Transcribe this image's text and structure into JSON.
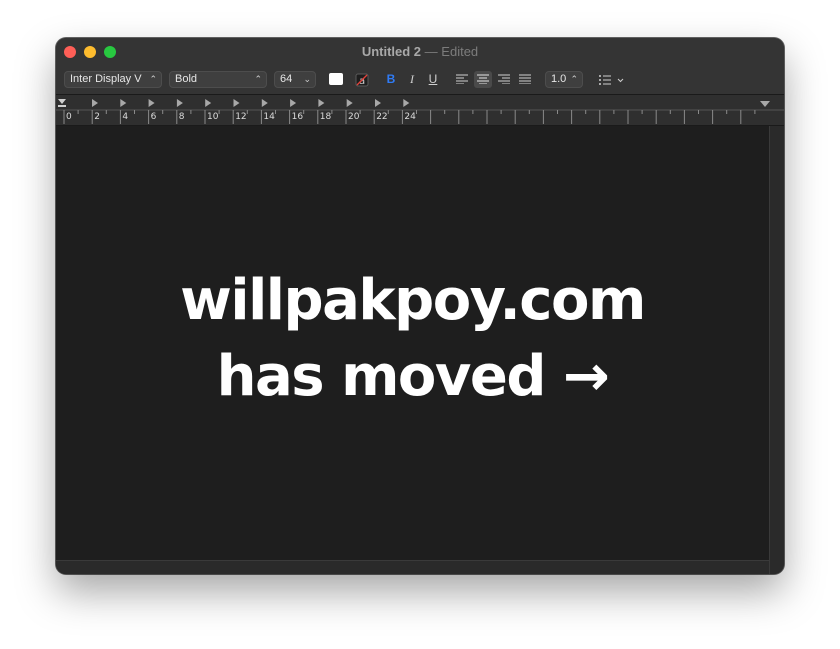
{
  "window": {
    "title": "Untitled 2",
    "separator": "—",
    "status": "Edited"
  },
  "toolbar": {
    "font_family": "Inter Display V",
    "font_style": "Bold",
    "font_size": "64",
    "text_color": "#ffffff",
    "bold_label": "B",
    "italic_label": "I",
    "underline_label": "U",
    "line_spacing": "1.0",
    "active_alignment": "center",
    "bold_active_color": "#2f7bf5"
  },
  "ruler": {
    "labels": [
      "0",
      "2",
      "4",
      "6",
      "8",
      "10",
      "12",
      "14",
      "16",
      "18",
      "20",
      "22",
      "24"
    ]
  },
  "document": {
    "line1": "willpakpoy.com",
    "line2": "has moved →"
  }
}
